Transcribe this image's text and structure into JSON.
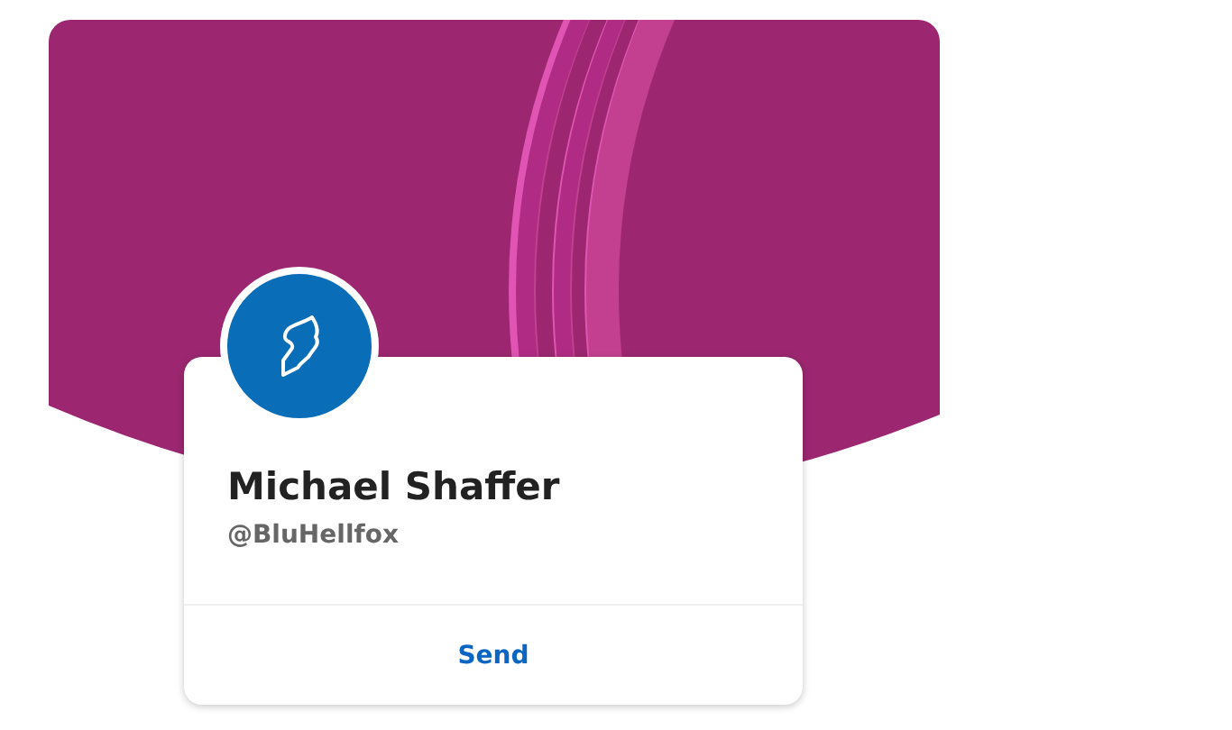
{
  "profile": {
    "name": "Michael Shaffer",
    "handle": "@BluHellfox"
  },
  "actions": [
    {
      "label": "Send"
    }
  ]
}
